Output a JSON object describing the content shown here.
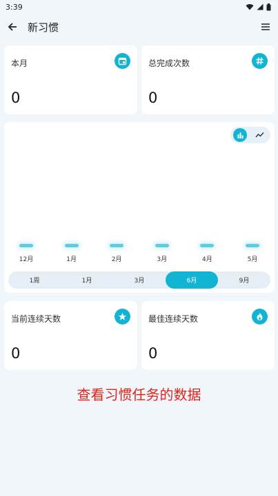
{
  "status_bar": {
    "time": "3:39"
  },
  "app_bar": {
    "title": "新习惯"
  },
  "stats_top": [
    {
      "label": "本月",
      "value": "0",
      "icon": "calendar-icon"
    },
    {
      "label": "总完成次数",
      "value": "0",
      "icon": "hash-icon"
    }
  ],
  "chart_toggle": {
    "active": "bar-chart-icon",
    "inactive": "line-chart-icon"
  },
  "chart_data": {
    "type": "bar",
    "categories": [
      "12月",
      "1月",
      "2月",
      "3月",
      "4月",
      "5月"
    ],
    "values": [
      0,
      0,
      0,
      0,
      0,
      0
    ],
    "title": "",
    "xlabel": "",
    "ylabel": ""
  },
  "range_options": [
    "1周",
    "1月",
    "3月",
    "6月",
    "9月"
  ],
  "range_selected": "6月",
  "stats_bottom": [
    {
      "label": "当前连续天数",
      "value": "0",
      "icon": "star-icon"
    },
    {
      "label": "最佳连续天数",
      "value": "0",
      "icon": "fire-icon"
    }
  ],
  "colors": {
    "accent": "#12b4d3",
    "bar": "#5fcde0",
    "caption": "#e2231a",
    "background": "#f1f6fb"
  },
  "caption": "查看习惯任务的数据"
}
